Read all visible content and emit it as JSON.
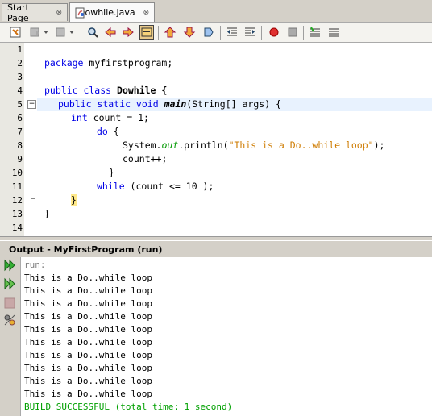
{
  "tabs": [
    {
      "label": "Start Page",
      "close": "⊖"
    },
    {
      "label": "Dowhile.java",
      "close": "⊖"
    }
  ],
  "editor": {
    "line_numbers": [
      "1",
      "2",
      "3",
      "4",
      "5",
      "6",
      "7",
      "8",
      "9",
      "10",
      "11",
      "12",
      "13",
      "14"
    ],
    "lines": {
      "l2_kw": "package",
      "l2_rest": " myfirstprogram;",
      "l4_kw": "public class",
      "l4_rest": " Dowhile {",
      "l5_kw": "public static void",
      "l5_name": "main",
      "l5_rest": "(String[] args) {",
      "l6_kw": "int",
      "l6_rest": " count = 1;",
      "l7_kw": "do",
      "l7_rest": " {",
      "l8_a": "System.",
      "l8_out": "out",
      "l8_b": ".println(",
      "l8_str": "\"This is a Do..while loop\"",
      "l8_c": ");",
      "l9": "count++;",
      "l10": "}",
      "l11_kw": "while",
      "l11_rest": " (count <= 10 );",
      "l12": "}",
      "l13": "}"
    },
    "fold_marker": "−"
  },
  "output": {
    "title": "Output - MyFirstProgram (run)",
    "lines": [
      "run:",
      "This is a Do..while loop",
      "This is a Do..while loop",
      "This is a Do..while loop",
      "This is a Do..while loop",
      "This is a Do..while loop",
      "This is a Do..while loop",
      "This is a Do..while loop",
      "This is a Do..while loop",
      "This is a Do..while loop",
      "This is a Do..while loop",
      "BUILD SUCCESSFUL (total time: 1 second)"
    ]
  }
}
